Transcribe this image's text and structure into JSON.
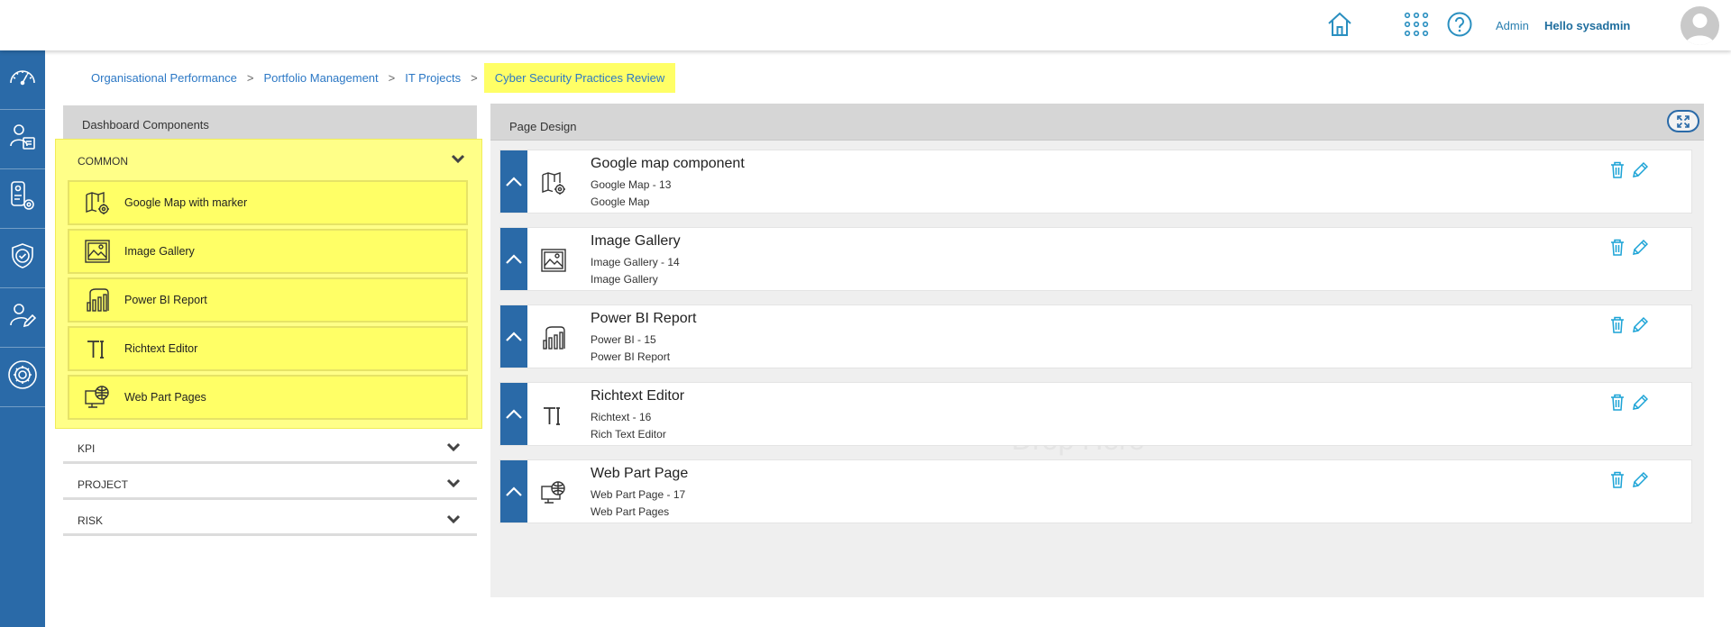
{
  "header": {
    "admin_label": "Admin",
    "hello_label": "Hello sysadmin",
    "icons": [
      "home-icon",
      "apps-grid-icon",
      "help-icon",
      "avatar"
    ]
  },
  "sidebar": {
    "items": [
      "dashboard-gauge-icon",
      "user-document-icon",
      "settings-phone-icon",
      "shield-check-icon",
      "user-edit-icon",
      "gear-icon"
    ]
  },
  "breadcrumb": {
    "items": [
      "Organisational Performance",
      "Portfolio Management",
      "IT Projects"
    ],
    "separator": ">",
    "current": "Cyber Security Practices Review"
  },
  "components_panel": {
    "title": "Dashboard Components",
    "common": {
      "label": "COMMON",
      "items": [
        {
          "label": "Google Map with marker",
          "icon": "map-gear-icon"
        },
        {
          "label": "Image Gallery",
          "icon": "image-icon"
        },
        {
          "label": "Power BI Report",
          "icon": "power-bi-icon"
        },
        {
          "label": "Richtext Editor",
          "icon": "text-icon"
        },
        {
          "label": "Web Part Pages",
          "icon": "web-part-icon"
        }
      ]
    },
    "sections": [
      {
        "label": "KPI"
      },
      {
        "label": "PROJECT"
      },
      {
        "label": "RISK"
      }
    ]
  },
  "page_design": {
    "title": "Page Design",
    "watermark": "Drop Here",
    "cards": [
      {
        "title": "Google map component",
        "subtitle": "Google Map - 13",
        "type": "Google Map",
        "icon": "map-gear-icon"
      },
      {
        "title": "Image Gallery",
        "subtitle": "Image Gallery - 14",
        "type": "Image Gallery",
        "icon": "image-icon"
      },
      {
        "title": "Power BI Report",
        "subtitle": "Power BI - 15",
        "type": "Power BI Report",
        "icon": "power-bi-icon"
      },
      {
        "title": "Richtext Editor",
        "subtitle": "Richtext - 16",
        "type": "Rich Text Editor",
        "icon": "text-icon"
      },
      {
        "title": "Web Part Page",
        "subtitle": "Web Part Page - 17",
        "type": "Web Part Pages",
        "icon": "web-part-icon"
      }
    ]
  },
  "colors": {
    "sidebar": "#2a6aa8",
    "highlight": "#ffff66",
    "link": "#2c78c5",
    "action_icons": "#1ba3d6"
  }
}
